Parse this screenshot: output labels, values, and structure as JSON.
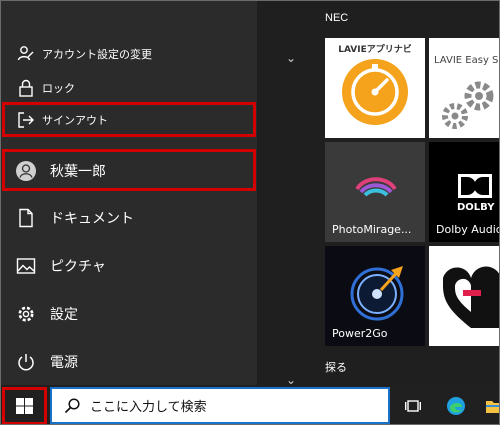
{
  "start_menu": {
    "items": {
      "account": "アカウント設定の変更",
      "lock": "ロック",
      "signout": "サインアウト",
      "user": "秋葉一郎",
      "documents": "ドキュメント",
      "pictures": "ピクチャ",
      "settings": "設定",
      "power": "電源"
    }
  },
  "tiles": {
    "group_label": "NEC",
    "lavie_app_title": "LAVIEアプリナビ",
    "lavie_easy_title": "LAVIE Easy Set",
    "photomirage_label": "PhotoMirage...",
    "dolby_logo": "DOLBY",
    "dolby_label": "Dolby Audio",
    "power2go_label": "Power2Go",
    "explore_label": "探る"
  },
  "taskbar": {
    "search_placeholder": "ここに入力して検索"
  },
  "colors": {
    "highlight": "#d40000",
    "lavie_orange": "#f5a21c",
    "search_border": "#1a73c8"
  }
}
